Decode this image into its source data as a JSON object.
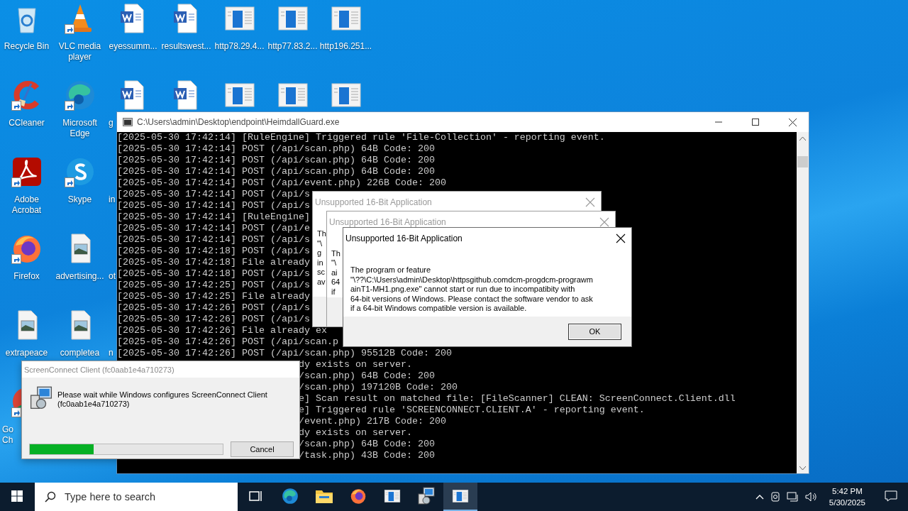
{
  "desktop_icons": [
    [
      {
        "kind": "recycle",
        "label": "Recycle Bin",
        "shortcut": false,
        "clipped": false
      },
      {
        "kind": "vlc",
        "label": "VLC media player",
        "shortcut": true,
        "clipped": false
      },
      {
        "kind": "word",
        "label": "eyessumm...",
        "shortcut": false,
        "clipped": false
      },
      {
        "kind": "word",
        "label": "resultswest...",
        "shortcut": false,
        "clipped": false
      },
      {
        "kind": "webpage",
        "label": "http78.29.4...",
        "shortcut": false,
        "clipped": false
      },
      {
        "kind": "webpage",
        "label": "http77.83.2...",
        "shortcut": false,
        "clipped": false
      },
      {
        "kind": "webpage",
        "label": "http196.251...",
        "shortcut": false,
        "clipped": false
      }
    ],
    [
      {
        "kind": "ccleaner",
        "label": "CCleaner",
        "shortcut": true,
        "clipped": false
      },
      {
        "kind": "edge",
        "label": "Microsoft Edge",
        "shortcut": true,
        "clipped": false
      },
      {
        "kind": "word",
        "label": "g",
        "shortcut": false,
        "clipped": true
      },
      {
        "kind": "word",
        "shortcut": false
      },
      {
        "kind": "webpage",
        "shortcut": false
      },
      {
        "kind": "webpage",
        "shortcut": false
      },
      {
        "kind": "webpage",
        "shortcut": false
      }
    ],
    [
      {
        "kind": "acrobat",
        "label": "Adobe Acrobat",
        "shortcut": true,
        "clipped": false
      },
      {
        "kind": "skype",
        "label": "Skype",
        "shortcut": true,
        "clipped": false
      },
      {
        "label": "in",
        "clipped": true
      }
    ],
    [
      {
        "kind": "firefox",
        "label": "Firefox",
        "shortcut": true,
        "clipped": false
      },
      {
        "kind": "image",
        "label": "advertising...",
        "shortcut": false,
        "clipped": false
      },
      {
        "label": "ot",
        "clipped": true
      }
    ],
    [
      {
        "kind": "image",
        "label": "extrapeace",
        "shortcut": false,
        "clipped": false
      },
      {
        "kind": "image",
        "label": "completea",
        "shortcut": false,
        "clipped": false
      },
      {
        "label": "n",
        "clipped": true
      }
    ],
    [
      {
        "kind": "chrome",
        "label": "Go\nCh",
        "shortcut": true,
        "clipped": true
      }
    ]
  ],
  "console": {
    "title": "C:\\Users\\admin\\Desktop\\endpoint\\HeimdallGuard.exe",
    "lines": [
      {
        "kind": "full",
        "text": "[2025-05-30 17:42:14] [RuleEngine] Triggered rule 'File-Collection' - reporting event."
      },
      {
        "kind": "full",
        "text": "[2025-05-30 17:42:14] POST (/api/scan.php) 64B Code: 200"
      },
      {
        "kind": "full",
        "text": "[2025-05-30 17:42:14] POST (/api/scan.php) 64B Code: 200"
      },
      {
        "kind": "full",
        "text": "[2025-05-30 17:42:14] POST (/api/scan.php) 64B Code: 200"
      },
      {
        "kind": "full",
        "text": "[2025-05-30 17:42:14] POST (/api/event.php) 226B Code: 200"
      },
      {
        "kind": "full",
        "text": "[2025-05-30 17:42:14] POST (/api/s"
      },
      {
        "kind": "full",
        "text": "[2025-05-30 17:42:14] POST (/api/s"
      },
      {
        "kind": "full",
        "text": "[2025-05-30 17:42:14] [RuleEngine]"
      },
      {
        "kind": "full",
        "text": "[2025-05-30 17:42:14] POST (/api/e"
      },
      {
        "kind": "full",
        "text": "[2025-05-30 17:42:14] POST (/api/s"
      },
      {
        "kind": "full",
        "text": "[2025-05-30 17:42:18] POST (/api/s"
      },
      {
        "kind": "full",
        "text": "[2025-05-30 17:42:18] File already"
      },
      {
        "kind": "full",
        "text": "[2025-05-30 17:42:18] POST (/api/s"
      },
      {
        "kind": "full",
        "text": "[2025-05-30 17:42:25] POST (/api/s"
      },
      {
        "kind": "full",
        "text": "[2025-05-30 17:42:25] File already"
      },
      {
        "kind": "full",
        "text": "[2025-05-30 17:42:26] POST (/api/s"
      },
      {
        "kind": "full",
        "text": "[2025-05-30 17:42:26] POST (/api/s"
      },
      {
        "kind": "full",
        "text": "[2025-05-30 17:42:26] File already ex"
      },
      {
        "kind": "full",
        "text": "[2025-05-30 17:42:26] POST (/api/scan.p"
      },
      {
        "kind": "full",
        "text": "[2025-05-30 17:42:26] POST (/api/scan.php) 95512B Code: 200"
      },
      {
        "kind": "tail",
        "text": "dy exists on server."
      },
      {
        "kind": "tail",
        "text": "/scan.php) 64B Code: 200"
      },
      {
        "kind": "tail",
        "text": "/scan.php) 197120B Code: 200"
      },
      {
        "kind": "tail",
        "text": "e] Scan result on matched file: [FileScanner] CLEAN: ScreenConnect.Client.dll"
      },
      {
        "kind": "tail",
        "text": "e] Triggered rule 'SCREENCONNECT.CLIENT.A' - reporting event."
      },
      {
        "kind": "tail",
        "text": "/event.php) 217B Code: 200"
      },
      {
        "kind": "tail",
        "text": "dy exists on server."
      },
      {
        "kind": "tail",
        "text": "/scan.php) 64B Code: 200"
      },
      {
        "kind": "tail",
        "text": "/task.php) 43B Code: 200"
      }
    ]
  },
  "dialogs": [
    {
      "title": "Unsupported 16-Bit Application",
      "active": false,
      "body_lines": [
        "Th",
        "\"\\",
        "g",
        "in",
        "sc",
        "av"
      ]
    },
    {
      "title": "Unsupported 16-Bit Application",
      "active": false,
      "body_lines": [
        "Th",
        "\"\\",
        "ai",
        "64",
        "if"
      ]
    },
    {
      "title": "Unsupported 16-Bit Application",
      "active": true,
      "body_lines": [
        "The program or feature",
        "\"\\??\\C:\\Users\\admin\\Desktop\\httpsgithub.comdcm-progdcm-prograwm",
        "ainT1-MH1.png.exe\" cannot start or run due to incompatibity with",
        "64-bit versions of Windows. Please contact the software vendor to ask",
        "if a 64-bit Windows compatible version is available."
      ],
      "button": "OK"
    }
  ],
  "installer": {
    "title": "ScreenConnect Client (fc0aab1e4a710273)",
    "message_lines": [
      "Please wait while Windows configures ScreenConnect Client",
      "(fc0aab1e4a710273)"
    ],
    "level": 0.33,
    "button": "Cancel"
  },
  "taskbar": {
    "search": {
      "placeholder": "Type here to search"
    },
    "apps": [
      {
        "kind": "taskview",
        "selected": false
      },
      {
        "kind": "edge",
        "selected": false
      },
      {
        "kind": "explorer",
        "selected": false
      },
      {
        "kind": "firefox",
        "selected": false
      },
      {
        "kind": "webpage",
        "selected": false
      },
      {
        "kind": "installer",
        "selected": false
      },
      {
        "kind": "console",
        "selected": true
      }
    ],
    "time": "5:42 PM",
    "date": "5/30/2025"
  }
}
